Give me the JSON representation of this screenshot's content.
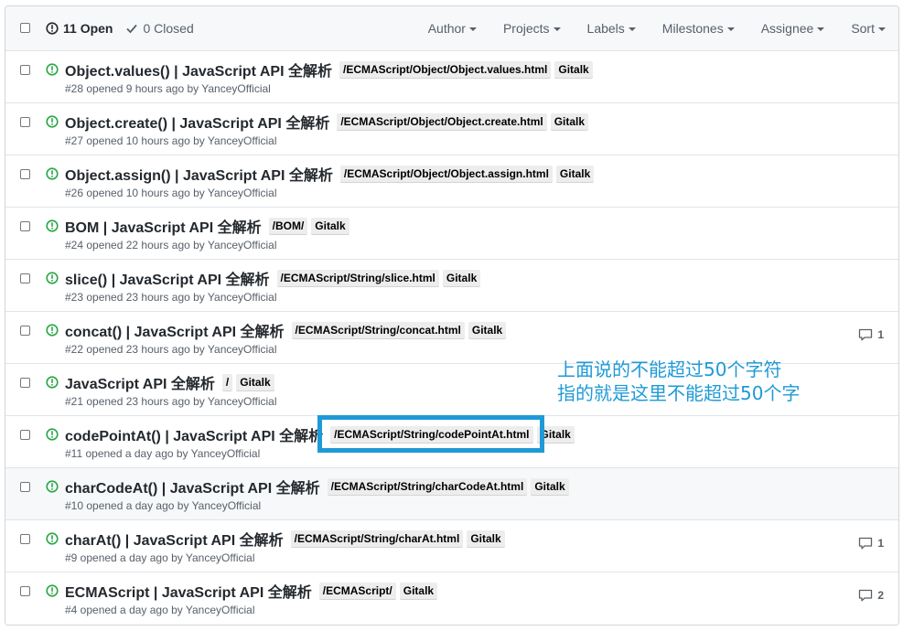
{
  "header": {
    "open_label": "11 Open",
    "closed_label": "0 Closed",
    "filters": [
      "Author",
      "Projects",
      "Labels",
      "Milestones",
      "Assignee",
      "Sort"
    ]
  },
  "issues": [
    {
      "title": "Object.values() | JavaScript API 全解析",
      "labels": [
        "/ECMAScript/Object/Object.values.html",
        "Gitalk"
      ],
      "meta": "#28 opened 9 hours ago by YanceyOfficial",
      "comments": ""
    },
    {
      "title": "Object.create() | JavaScript API 全解析",
      "labels": [
        "/ECMAScript/Object/Object.create.html",
        "Gitalk"
      ],
      "meta": "#27 opened 10 hours ago by YanceyOfficial",
      "comments": ""
    },
    {
      "title": "Object.assign() | JavaScript API 全解析",
      "labels": [
        "/ECMAScript/Object/Object.assign.html",
        "Gitalk"
      ],
      "meta": "#26 opened 10 hours ago by YanceyOfficial",
      "comments": ""
    },
    {
      "title": "BOM | JavaScript API 全解析",
      "labels": [
        "/BOM/",
        "Gitalk"
      ],
      "meta": "#24 opened 22 hours ago by YanceyOfficial",
      "comments": ""
    },
    {
      "title": "slice() | JavaScript API 全解析",
      "labels": [
        "/ECMAScript/String/slice.html",
        "Gitalk"
      ],
      "meta": "#23 opened 23 hours ago by YanceyOfficial",
      "comments": ""
    },
    {
      "title": "concat() | JavaScript API 全解析",
      "labels": [
        "/ECMAScript/String/concat.html",
        "Gitalk"
      ],
      "meta": "#22 opened 23 hours ago by YanceyOfficial",
      "comments": "1"
    },
    {
      "title": "JavaScript API 全解析",
      "labels": [
        "/",
        "Gitalk"
      ],
      "meta": "#21 opened 23 hours ago by YanceyOfficial",
      "comments": ""
    },
    {
      "title": "codePointAt() | JavaScript API 全解析",
      "labels": [
        "/ECMAScript/String/codePointAt.html",
        "Gitalk"
      ],
      "meta": "#11 opened a day ago by YanceyOfficial",
      "comments": ""
    },
    {
      "title": "charCodeAt() | JavaScript API 全解析",
      "labels": [
        "/ECMAScript/String/charCodeAt.html",
        "Gitalk"
      ],
      "meta": "#10 opened a day ago by YanceyOfficial",
      "comments": ""
    },
    {
      "title": "charAt() | JavaScript API 全解析",
      "labels": [
        "/ECMAScript/String/charAt.html",
        "Gitalk"
      ],
      "meta": "#9 opened a day ago by YanceyOfficial",
      "comments": "1"
    },
    {
      "title": "ECMAScript | JavaScript API 全解析",
      "labels": [
        "/ECMAScript/",
        "Gitalk"
      ],
      "meta": "#4 opened a day ago by YanceyOfficial",
      "comments": "2"
    }
  ],
  "annotation": {
    "line1": "上面说的不能超过50个字符",
    "line2": "指的就是这里不能超过50个字",
    "color": "#1f9ad6"
  },
  "colors": {
    "issue_open": "#28a745",
    "label_bg": "#ededed",
    "border": "#e1e4e8"
  }
}
